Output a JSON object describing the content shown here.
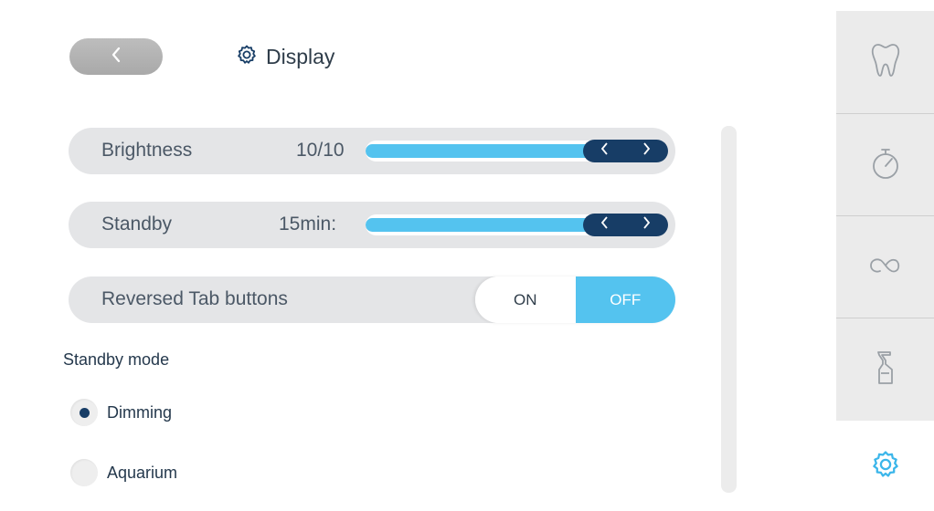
{
  "header": {
    "back_icon": "chevron-left-icon",
    "title_icon": "gear-icon",
    "title": "Display"
  },
  "settings": {
    "brightness": {
      "label": "Brightness",
      "value": "10/10",
      "level": 1.0
    },
    "standby": {
      "label": "Standby",
      "value": "15min:",
      "level": 1.0
    },
    "reversed_tabs": {
      "label": "Reversed Tab buttons",
      "on_label": "ON",
      "off_label": "OFF",
      "selected": "OFF"
    }
  },
  "standby_mode": {
    "label": "Standby mode",
    "options": [
      {
        "label": "Dimming",
        "selected": true
      },
      {
        "label": "Aquarium",
        "selected": false
      }
    ]
  },
  "nav": {
    "items": [
      {
        "icon": "tooth-icon",
        "active": false
      },
      {
        "icon": "stopwatch-icon",
        "active": false
      },
      {
        "icon": "infinity-icon",
        "active": false
      },
      {
        "icon": "spray-bottle-icon",
        "active": false
      },
      {
        "icon": "gear-icon",
        "active": true
      }
    ]
  },
  "colors": {
    "accent": "#54c3ef",
    "dark": "#173d66",
    "row_bg": "#e4e5e7",
    "nav_bg": "#ebebeb"
  }
}
